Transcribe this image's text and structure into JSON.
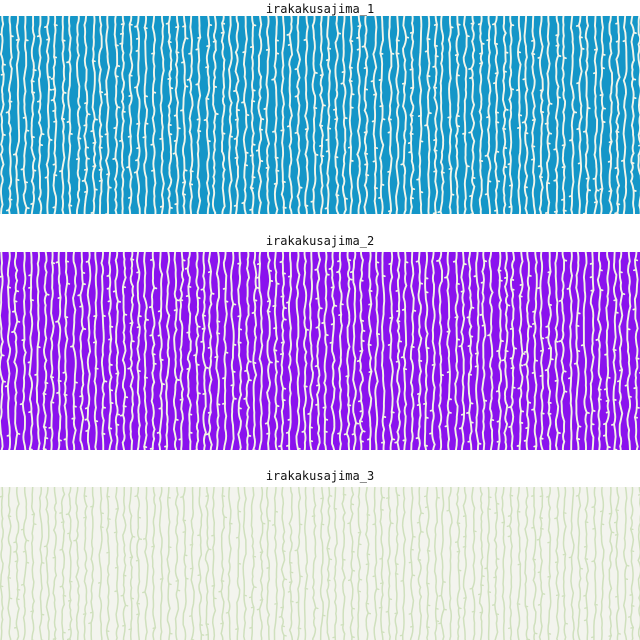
{
  "patterns": [
    {
      "title": "irakakusajima_1",
      "background_color": "#1496c8",
      "stripe_color": "#f2f5ea"
    },
    {
      "title": "irakakusajima_2",
      "background_color": "#8a12ee",
      "stripe_color": "#f3f4e4"
    },
    {
      "title": "irakakusajima_3",
      "background_color": "#f3f4ee",
      "stripe_color": "#cfe0bd"
    }
  ]
}
